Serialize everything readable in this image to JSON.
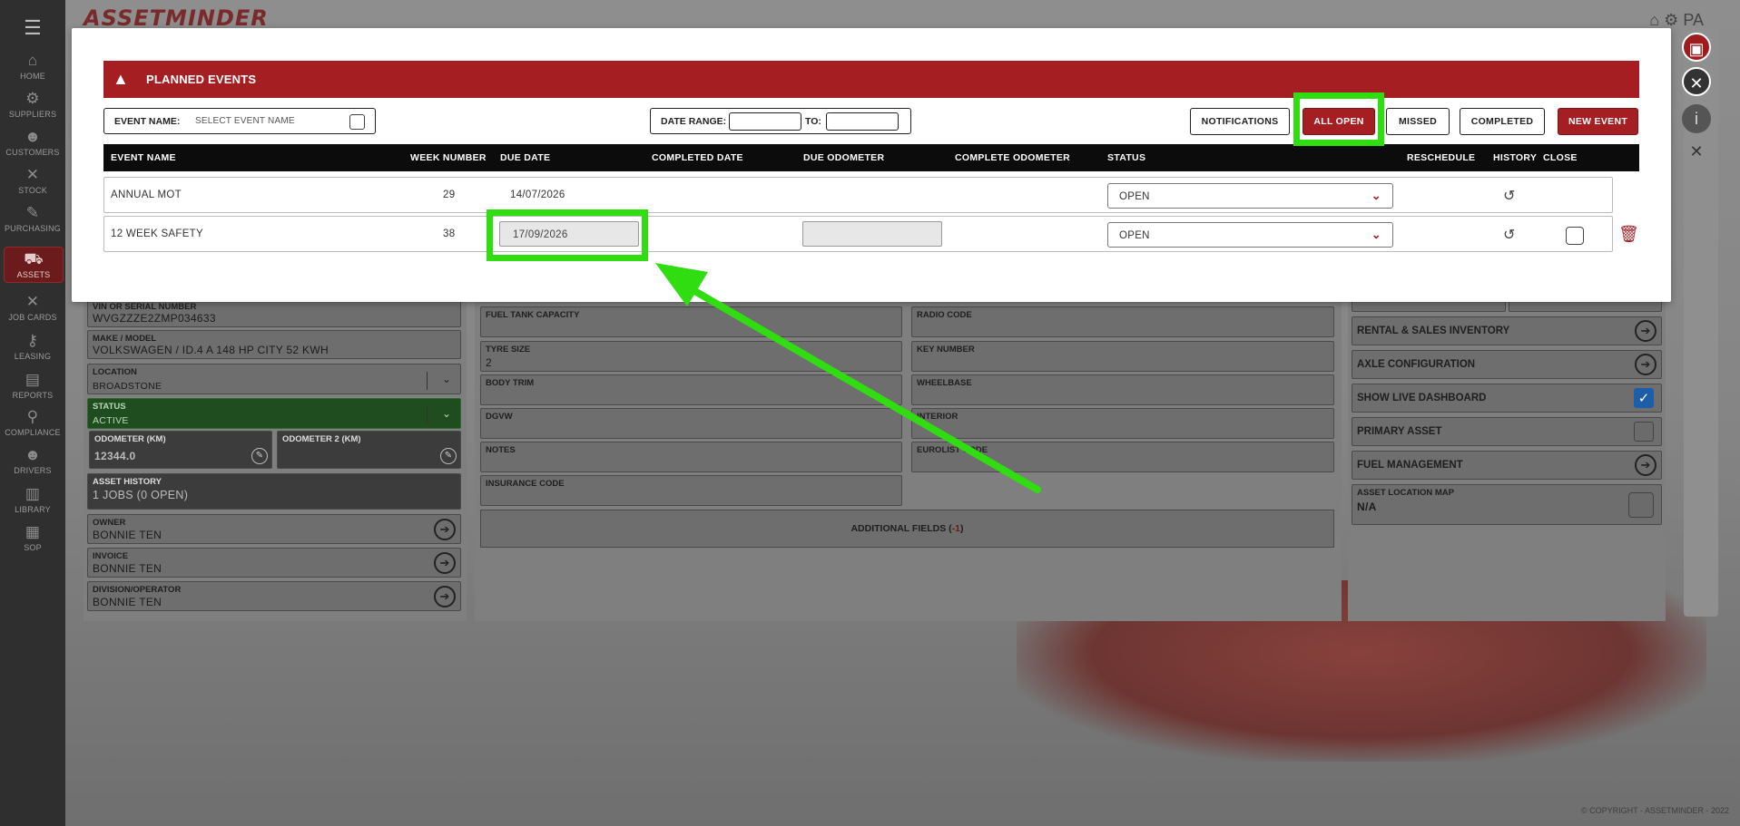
{
  "app": {
    "logo_text": "ASSETMINDER",
    "user_initials": "PA",
    "copyright": "© COPYRIGHT - ASSETMINDER - 2022"
  },
  "sidebar": {
    "items": [
      {
        "label": "HOME",
        "icon": "home-icon"
      },
      {
        "label": "SUPPLIERS",
        "icon": "suppliers-icon"
      },
      {
        "label": "CUSTOMERS",
        "icon": "customers-icon"
      },
      {
        "label": "STOCK",
        "icon": "stock-icon"
      },
      {
        "label": "PURCHASING",
        "icon": "purchasing-icon"
      },
      {
        "label": "ASSETS",
        "icon": "truck-icon",
        "active": true
      },
      {
        "label": "JOB CARDS",
        "icon": "job-cards-icon"
      },
      {
        "label": "LEASING",
        "icon": "leasing-icon"
      },
      {
        "label": "REPORTS",
        "icon": "reports-icon"
      },
      {
        "label": "COMPLIANCE",
        "icon": "compliance-icon"
      },
      {
        "label": "DRIVERS",
        "icon": "drivers-icon"
      },
      {
        "label": "LIBRARY",
        "icon": "library-icon"
      },
      {
        "label": "SOP",
        "icon": "sop-icon"
      }
    ]
  },
  "asset": {
    "vin_label": "VIN OR SERIAL NUMBER",
    "vin_value": "WVGZZZE2ZMP034633",
    "make_label": "MAKE / MODEL",
    "make_value": "VOLKSWAGEN / ID.4 A 148 HP CITY 52 KWH",
    "location_label": "LOCATION",
    "location_value": "BROADSTONE",
    "status_label": "STATUS",
    "status_value": "ACTIVE",
    "odo_label": "ODOMETER (KM)",
    "odo_value": "12344.0",
    "odo2_label": "ODOMETER 2 (KM)",
    "history_label": "ASSET HISTORY",
    "history_value": "1 JOBS (0 OPEN)",
    "owner_label": "OWNER",
    "owner_value": "BONNIE TEN",
    "invoice_label": "INVOICE",
    "invoice_value": "BONNIE TEN",
    "division_label": "DIVISION/OPERATOR",
    "division_value": "BONNIE TEN"
  },
  "mid": {
    "fuel_tank_label": "FUEL TANK CAPACITY",
    "tyre_label": "TYRE SIZE",
    "tyre_value": "2",
    "body_trim_label": "BODY TRIM",
    "dgvw_label": "DGVW",
    "notes_label": "NOTES",
    "insurance_label": "INSURANCE CODE",
    "radio_label": "RADIO CODE",
    "key_label": "KEY NUMBER",
    "wheelbase_label": "WHEELBASE",
    "interior_label": "INTERIOR",
    "eurolist_label": "EUROLIST CODE",
    "additional_label": "ADDITIONAL FIELDS (",
    "additional_count": "-1",
    "additional_close": ")"
  },
  "right": {
    "rental_label": "RENTAL & SALES INVENTORY",
    "axle_label": "AXLE CONFIGURATION",
    "live_dash_label": "SHOW LIVE DASHBOARD",
    "live_dash_checked": true,
    "primary_label": "PRIMARY ASSET",
    "primary_checked": false,
    "fuel_label": "FUEL MANAGEMENT",
    "map_label": "ASSET LOCATION MAP",
    "map_value": "N/A"
  },
  "modal": {
    "title": "PLANNED EVENTS",
    "event_name_label": "EVENT NAME:",
    "event_name_placeholder": "SELECT EVENT NAME",
    "date_range_label": "DATE RANGE:",
    "to_label": "TO:",
    "buttons": {
      "notifications": "NOTIFICATIONS",
      "all_open": "ALL OPEN",
      "missed": "MISSED",
      "completed": "COMPLETED",
      "new_event": "NEW EVENT"
    },
    "columns": {
      "event_name": "EVENT NAME",
      "week_number": "WEEK NUMBER",
      "due_date": "DUE DATE",
      "completed_date": "COMPLETED DATE",
      "due_odometer": "DUE ODOMETER",
      "complete_odometer": "COMPLETE ODOMETER",
      "status": "STATUS",
      "reschedule": "RESCHEDULE",
      "history": "HISTORY",
      "close": "CLOSE"
    },
    "rows": [
      {
        "event_name": "ANNUAL MOT",
        "week_number": "29",
        "due_date": "14/07/2026",
        "status": "OPEN"
      },
      {
        "event_name": "12 WEEK SAFETY",
        "week_number": "38",
        "due_date": "17/09/2026",
        "status": "OPEN"
      }
    ]
  },
  "colors": {
    "brand_red": "#a51e22",
    "highlight_green": "#2fdd10",
    "header_black": "#0c0c0c"
  }
}
